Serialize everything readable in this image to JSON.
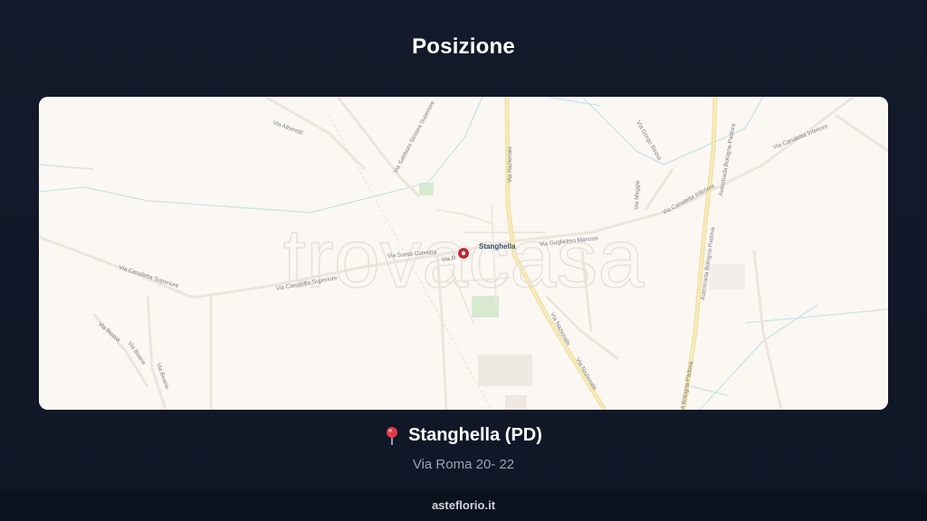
{
  "header": {
    "title": "Posizione"
  },
  "map": {
    "watermark": "trovacasa",
    "labels": {
      "place": "Stanghella",
      "via_alberetti": "Via Alberetti",
      "via_sabbioni": "Via Sabbioni Sinistra Superiore",
      "via_nazionale_n": "Via Nazionale",
      "via_nazionale_s": "Via Nazionale",
      "via_nazionale_s2": "Via Nazionale",
      "via_gorgo": "Via Gorgo Bassa",
      "via_canaletta_inf": "Via Canaletta Inferiore",
      "via_canaletta_inf2": "Via Canaletta Inferiore",
      "via_canaletta_sup": "Via Canaletta Superiore",
      "via_canaletta_sup2": "Via Canaletta Superiore",
      "via_santa_caterina": "Via Santa Caterina",
      "via_roma_short": "Via R",
      "via_guglielmo": "Via Guglielmo Marconi",
      "via_meggia": "Via Meggia",
      "via_boaria": "Via Boaria",
      "via_boaria2": "Via Boaria",
      "via_rossa": "Via Rossa",
      "autostrada": "Autostrada Bologna-Padova",
      "autostrada2": "Autostrada Bologna-Padova",
      "autostrada3": "A Bologna-Padova"
    },
    "colors": {
      "pin": "#c0272d",
      "major_road": "#f1e3a6",
      "water": "#bfe0e6",
      "park": "#d7ead0"
    }
  },
  "location": {
    "name": "Stanghella (PD)",
    "address": "Via Roma 20- 22",
    "icon": "map-pin-icon"
  },
  "footer": {
    "site": "asteflorio.it"
  }
}
